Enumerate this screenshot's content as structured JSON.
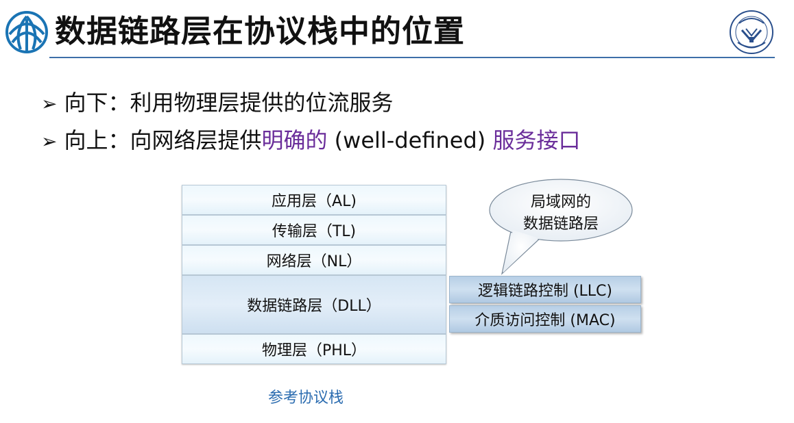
{
  "title": "数据链路层在协议栈中的位置",
  "bullets": {
    "b1": "向下：利用物理层提供的位流服务",
    "b2_prefix": "向上：向网络层提供",
    "b2_highlight1": "明确的",
    "b2_middle": " (well-defined) ",
    "b2_highlight2": "服务接口"
  },
  "stack": {
    "al": "应用层（AL)",
    "tl": "传输层（TL)",
    "nl": "网络层（NL）",
    "dll": "数据链路层（DLL）",
    "phl": "物理层（PHL）",
    "llc": "逻辑链路控制 (LLC)",
    "mac": "介质访问控制 (MAC)"
  },
  "callout": {
    "line1": "局域网的",
    "line2": "数据链路层"
  },
  "caption": "参考协议栈",
  "colors": {
    "accent": "#6a2d9a",
    "caption": "#2b6cb0",
    "rule": "#3d6ea8"
  }
}
